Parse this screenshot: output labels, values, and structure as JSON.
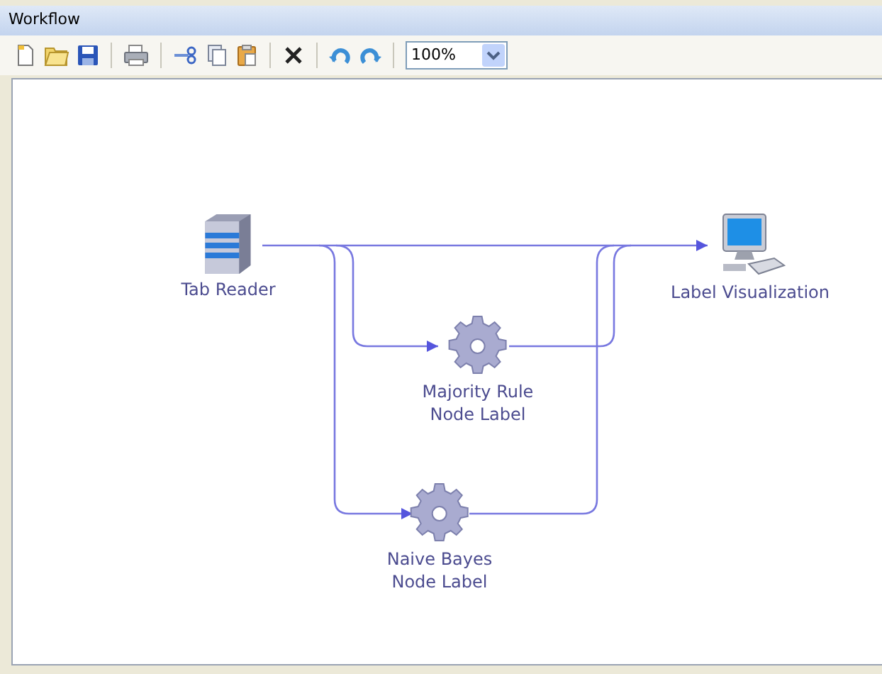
{
  "window": {
    "title": "Workflow"
  },
  "toolbar": {
    "zoom": {
      "value": "100%"
    }
  },
  "nodes": [
    {
      "kind": "reader",
      "label": [
        "Tab Reader"
      ]
    },
    {
      "kind": "display",
      "label": [
        "Label Visualization"
      ]
    },
    {
      "kind": "process",
      "label": [
        "Majority Rule",
        "Node Label"
      ]
    },
    {
      "kind": "process",
      "label": [
        "Naive Bayes",
        "Node Label"
      ]
    }
  ]
}
